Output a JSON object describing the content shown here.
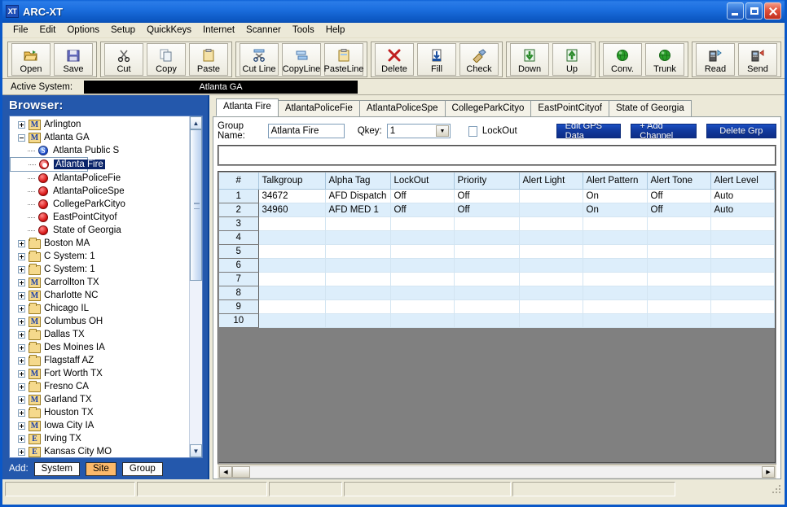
{
  "window": {
    "title": "ARC-XT",
    "app_icon": "XT",
    "minimize": "minimize-icon",
    "maximize": "maximize-icon",
    "close": "close-icon"
  },
  "menu": [
    "File",
    "Edit",
    "Options",
    "Setup",
    "QuickKeys",
    "Internet",
    "Scanner",
    "Tools",
    "Help"
  ],
  "toolbar_groups": [
    {
      "buttons": [
        {
          "label": "Open",
          "icon": "open-folder-icon"
        },
        {
          "label": "Save",
          "icon": "floppy-disk-icon"
        }
      ]
    },
    {
      "buttons": [
        {
          "label": "Cut",
          "icon": "scissors-icon"
        },
        {
          "label": "Copy",
          "icon": "copy-pages-icon"
        },
        {
          "label": "Paste",
          "icon": "clipboard-icon"
        }
      ]
    },
    {
      "buttons": [
        {
          "label": "Cut Line",
          "icon": "scissors-line-icon"
        },
        {
          "label": "CopyLine",
          "icon": "copy-line-icon"
        },
        {
          "label": "PasteLine",
          "icon": "paste-line-icon"
        }
      ]
    },
    {
      "buttons": [
        {
          "label": "Delete",
          "icon": "red-x-icon"
        },
        {
          "label": "Fill",
          "icon": "fill-down-icon"
        },
        {
          "label": "Check",
          "icon": "check-broom-icon"
        }
      ]
    },
    {
      "buttons": [
        {
          "label": "Down",
          "icon": "arrow-down-icon"
        },
        {
          "label": "Up",
          "icon": "arrow-up-icon"
        }
      ]
    },
    {
      "buttons": [
        {
          "label": "Conv.",
          "icon": "globe-icon"
        },
        {
          "label": "Trunk",
          "icon": "globe-icon"
        }
      ]
    },
    {
      "buttons": [
        {
          "label": "Read",
          "icon": "radio-read-icon"
        },
        {
          "label": "Send",
          "icon": "radio-send-icon"
        }
      ]
    }
  ],
  "active_system": {
    "label": "Active System:",
    "value": "Atlanta GA"
  },
  "sidebar": {
    "header": "Browser:",
    "nodes": [
      {
        "label": "Arlington",
        "icon": "m-folder-icon",
        "indent": 0,
        "expander": "plus",
        "selected": false
      },
      {
        "label": "Atlanta GA",
        "icon": "m-folder-icon",
        "indent": 0,
        "expander": "minus",
        "selected": false
      },
      {
        "label": "Atlanta Public S",
        "icon": "blue-s-circle-icon",
        "indent": 1,
        "expander": "none",
        "selected": false
      },
      {
        "label": "Atlanta Fire",
        "icon": "red-ring-icon",
        "indent": 1,
        "expander": "none",
        "selected": true
      },
      {
        "label": "AtlantaPoliceFie",
        "icon": "red-circle-icon",
        "indent": 1,
        "expander": "none",
        "selected": false
      },
      {
        "label": "AtlantaPoliceSpe",
        "icon": "red-circle-icon",
        "indent": 1,
        "expander": "none",
        "selected": false
      },
      {
        "label": "CollegeParkCityo",
        "icon": "red-circle-icon",
        "indent": 1,
        "expander": "none",
        "selected": false
      },
      {
        "label": "EastPointCityof",
        "icon": "red-circle-icon",
        "indent": 1,
        "expander": "none",
        "selected": false
      },
      {
        "label": "State of Georgia",
        "icon": "red-circle-icon",
        "indent": 1,
        "expander": "none",
        "selected": false
      },
      {
        "label": "Boston MA",
        "icon": "folder-icon",
        "indent": 0,
        "expander": "plus",
        "selected": false
      },
      {
        "label": "C System: 1",
        "icon": "folder-icon",
        "indent": 0,
        "expander": "plus",
        "selected": false
      },
      {
        "label": "C System: 1",
        "icon": "folder-icon",
        "indent": 0,
        "expander": "plus",
        "selected": false
      },
      {
        "label": "Carrollton TX",
        "icon": "m-folder-icon",
        "indent": 0,
        "expander": "plus",
        "selected": false
      },
      {
        "label": "Charlotte NC",
        "icon": "m-folder-icon",
        "indent": 0,
        "expander": "plus",
        "selected": false
      },
      {
        "label": "Chicago IL",
        "icon": "folder-icon",
        "indent": 0,
        "expander": "plus",
        "selected": false
      },
      {
        "label": "Columbus OH",
        "icon": "m-folder-icon",
        "indent": 0,
        "expander": "plus",
        "selected": false
      },
      {
        "label": "Dallas TX",
        "icon": "folder-icon",
        "indent": 0,
        "expander": "plus",
        "selected": false
      },
      {
        "label": "Des Moines IA",
        "icon": "folder-icon",
        "indent": 0,
        "expander": "plus",
        "selected": false
      },
      {
        "label": "Flagstaff AZ",
        "icon": "folder-icon",
        "indent": 0,
        "expander": "plus",
        "selected": false
      },
      {
        "label": "Fort Worth TX",
        "icon": "m-folder-icon",
        "indent": 0,
        "expander": "plus",
        "selected": false
      },
      {
        "label": "Fresno CA",
        "icon": "folder-icon",
        "indent": 0,
        "expander": "plus",
        "selected": false
      },
      {
        "label": "Garland TX",
        "icon": "m-folder-icon",
        "indent": 0,
        "expander": "plus",
        "selected": false
      },
      {
        "label": "Houston TX",
        "icon": "folder-icon",
        "indent": 0,
        "expander": "plus",
        "selected": false
      },
      {
        "label": "Iowa City IA",
        "icon": "m-folder-icon",
        "indent": 0,
        "expander": "plus",
        "selected": false
      },
      {
        "label": "Irving TX",
        "icon": "e-folder-icon",
        "indent": 0,
        "expander": "plus",
        "selected": false
      },
      {
        "label": "Kansas City MO",
        "icon": "e-folder-icon",
        "indent": 0,
        "expander": "plus",
        "selected": false
      }
    ],
    "add_label": "Add:",
    "add_buttons": [
      {
        "label": "System",
        "highlighted": false
      },
      {
        "label": "Site",
        "highlighted": true
      },
      {
        "label": "Group",
        "highlighted": false
      }
    ]
  },
  "tabs": [
    {
      "label": "Atlanta Fire",
      "active": true
    },
    {
      "label": "AtlantaPoliceFie",
      "active": false
    },
    {
      "label": "AtlantaPoliceSpe",
      "active": false
    },
    {
      "label": "CollegeParkCityo",
      "active": false
    },
    {
      "label": "EastPointCityof",
      "active": false
    },
    {
      "label": "State of Georgia",
      "active": false
    }
  ],
  "controls": {
    "group_name_label": "Group Name:",
    "group_name_value": "Atlanta Fire",
    "qkey_label": "Qkey:",
    "qkey_value": "1",
    "lockout_label": "LockOut",
    "lockout_checked": false,
    "edit_gps_label": "Edit GPS Data",
    "add_channel_label": "+ Add Channel",
    "delete_grp_label": "Delete Grp"
  },
  "grid": {
    "columns": [
      "#",
      "Talkgroup",
      "Alpha Tag",
      "LockOut",
      "Priority",
      "Alert Light",
      "Alert Pattern",
      "Alert Tone",
      "Alert Level"
    ],
    "rows": [
      {
        "num": "1",
        "talkgroup": "34672",
        "alpha_tag": "AFD Dispatch",
        "lockout": "Off",
        "priority": "Off",
        "alert_light": "",
        "alert_pattern": "On",
        "alert_tone": "Off",
        "alert_level": "Auto"
      },
      {
        "num": "2",
        "talkgroup": "34960",
        "alpha_tag": "AFD MED 1",
        "lockout": "Off",
        "priority": "Off",
        "alert_light": "",
        "alert_pattern": "On",
        "alert_tone": "Off",
        "alert_level": "Auto"
      },
      {
        "num": "3",
        "talkgroup": "",
        "alpha_tag": "",
        "lockout": "",
        "priority": "",
        "alert_light": "",
        "alert_pattern": "",
        "alert_tone": "",
        "alert_level": ""
      },
      {
        "num": "4",
        "talkgroup": "",
        "alpha_tag": "",
        "lockout": "",
        "priority": "",
        "alert_light": "",
        "alert_pattern": "",
        "alert_tone": "",
        "alert_level": ""
      },
      {
        "num": "5",
        "talkgroup": "",
        "alpha_tag": "",
        "lockout": "",
        "priority": "",
        "alert_light": "",
        "alert_pattern": "",
        "alert_tone": "",
        "alert_level": ""
      },
      {
        "num": "6",
        "talkgroup": "",
        "alpha_tag": "",
        "lockout": "",
        "priority": "",
        "alert_light": "",
        "alert_pattern": "",
        "alert_tone": "",
        "alert_level": ""
      },
      {
        "num": "7",
        "talkgroup": "",
        "alpha_tag": "",
        "lockout": "",
        "priority": "",
        "alert_light": "",
        "alert_pattern": "",
        "alert_tone": "",
        "alert_level": ""
      },
      {
        "num": "8",
        "talkgroup": "",
        "alpha_tag": "",
        "lockout": "",
        "priority": "",
        "alert_light": "",
        "alert_pattern": "",
        "alert_tone": "",
        "alert_level": ""
      },
      {
        "num": "9",
        "talkgroup": "",
        "alpha_tag": "",
        "lockout": "",
        "priority": "",
        "alert_light": "",
        "alert_pattern": "",
        "alert_tone": "",
        "alert_level": ""
      },
      {
        "num": "10",
        "talkgroup": "",
        "alpha_tag": "",
        "lockout": "",
        "priority": "",
        "alert_light": "",
        "alert_pattern": "",
        "alert_tone": "",
        "alert_level": ""
      }
    ]
  },
  "statusbar": {
    "panels": [
      "",
      "",
      "",
      "",
      ""
    ]
  },
  "colors": {
    "titlebar_blue": "#1c6fdf",
    "sidebar_blue": "#2458ac",
    "selection_blue": "#0a246a",
    "grid_alt_row": "#ddeefb",
    "button_blue": "#123a9e",
    "highlight_orange": "#fbb96a"
  }
}
